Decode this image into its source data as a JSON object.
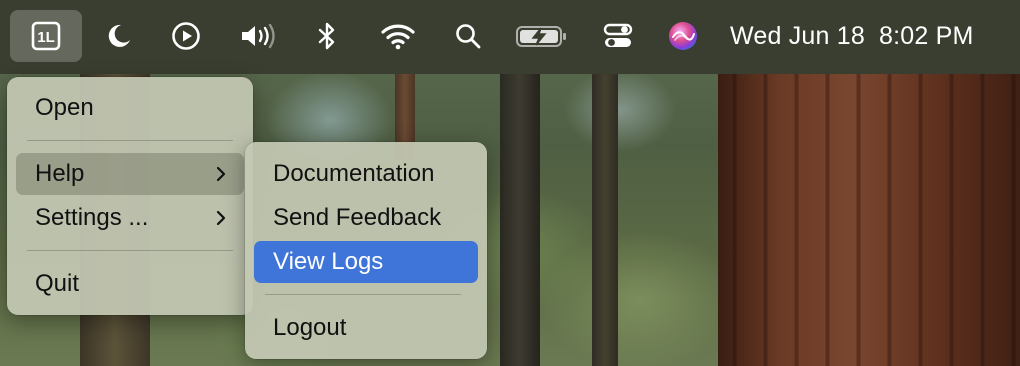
{
  "menubar": {
    "icons": [
      {
        "name": "app-logo-icon",
        "label": "1L"
      },
      {
        "name": "moon-icon"
      },
      {
        "name": "play-icon"
      },
      {
        "name": "volume-icon"
      },
      {
        "name": "bluetooth-icon"
      },
      {
        "name": "wifi-icon"
      },
      {
        "name": "search-icon"
      },
      {
        "name": "battery-charging-icon"
      },
      {
        "name": "control-center-icon"
      },
      {
        "name": "siri-icon"
      }
    ],
    "clock": {
      "date": "Wed Jun 18",
      "time": "8:02 PM"
    }
  },
  "main_menu": {
    "items": [
      {
        "label": "Open"
      },
      {
        "label": "Help",
        "has_submenu": true,
        "state": "highlighted"
      },
      {
        "label": "Settings ...",
        "has_submenu": true
      },
      {
        "label": "Quit"
      }
    ]
  },
  "help_submenu": {
    "items": [
      {
        "label": "Documentation"
      },
      {
        "label": "Send Feedback"
      },
      {
        "label": "View Logs",
        "state": "selected"
      },
      {
        "label": "Logout"
      }
    ]
  },
  "colors": {
    "menubar_bg": "#3a3e30",
    "menu_bg": "#c4c8b4",
    "selection": "#3f74d9",
    "submenu_hover": "#6e735f"
  }
}
